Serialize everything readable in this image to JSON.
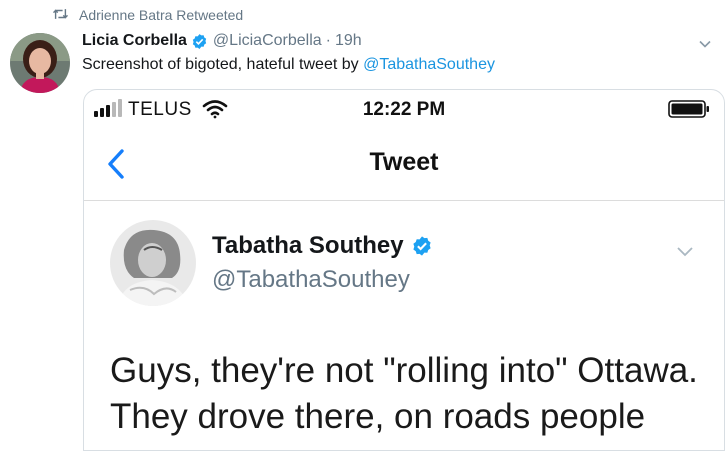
{
  "retweet": {
    "label": "Adrienne Batra Retweeted",
    "icon": "retweet-icon"
  },
  "tweet": {
    "author_name": "Licia Corbella",
    "author_handle": "@LiciaCorbella",
    "separator": "·",
    "time": "19h",
    "text_prefix": "Screenshot of bigoted, hateful tweet by ",
    "mention": "@TabathaSouthey"
  },
  "screenshot": {
    "status_bar": {
      "carrier": "TELUS",
      "time": "12:22 PM"
    },
    "nav": {
      "title": "Tweet"
    },
    "inner_tweet": {
      "author_name": "Tabatha Southey",
      "author_handle": "@TabathaSouthey",
      "text_line1": "Guys, they're not \"rolling into\" Ottawa.",
      "text_line2": "They drove there, on roads people"
    }
  },
  "colors": {
    "link": "#1b95e0",
    "verified": "#1da1f2",
    "ios_blue": "#157efb",
    "muted": "#657786"
  }
}
